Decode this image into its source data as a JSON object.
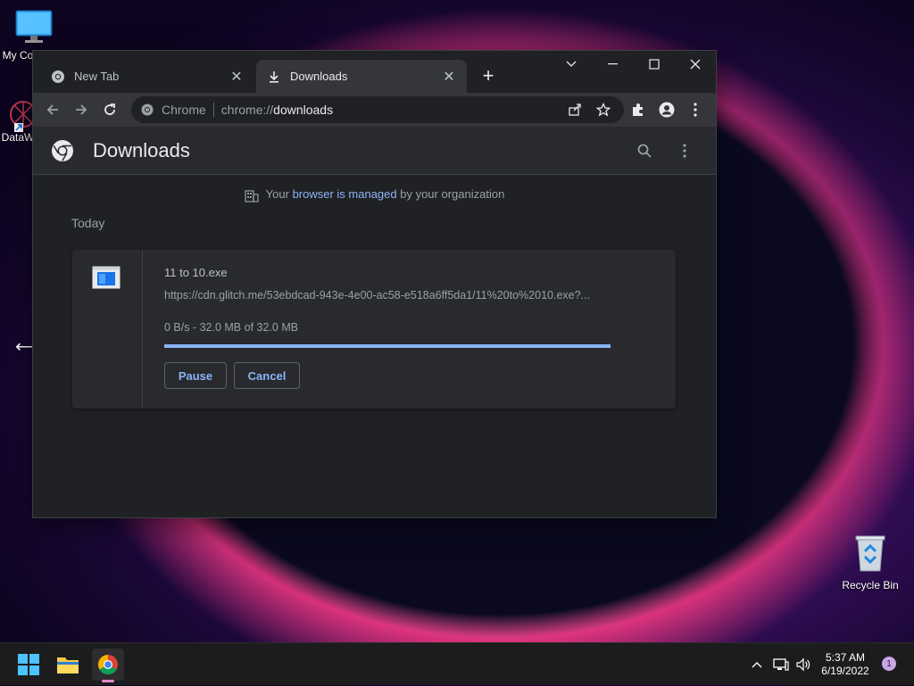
{
  "desktop": {
    "icons": [
      {
        "label": "My Co"
      },
      {
        "label": "DataW"
      },
      {
        "label": "Recycle Bin"
      }
    ]
  },
  "browser": {
    "tabs": [
      {
        "title": "New Tab",
        "active": false
      },
      {
        "title": "Downloads",
        "active": true
      }
    ],
    "omnibox": {
      "chip": "Chrome",
      "url_scheme": "chrome://",
      "url_host": "downloads"
    }
  },
  "downloads_page": {
    "title": "Downloads",
    "managed_notice": {
      "prefix": "Your ",
      "link": "browser is managed",
      "suffix": " by your organization"
    },
    "date_header": "Today",
    "items": [
      {
        "filename": "11 to 10.exe",
        "url": "https://cdn.glitch.me/53ebdcad-943e-4e00-ac58-e518a6ff5da1/11%20to%2010.exe?...",
        "status": "0 B/s - 32.0 MB of 32.0 MB",
        "progress_fraction": 1.0,
        "pause_label": "Pause",
        "cancel_label": "Cancel"
      }
    ]
  },
  "taskbar": {
    "time": "5:37 AM",
    "date": "6/19/2022",
    "notification_count": "1"
  },
  "colors": {
    "accent": "#8ab4f8",
    "page_bg": "#202124",
    "toolbar_bg": "#35363a",
    "card_bg": "#292a2d"
  }
}
